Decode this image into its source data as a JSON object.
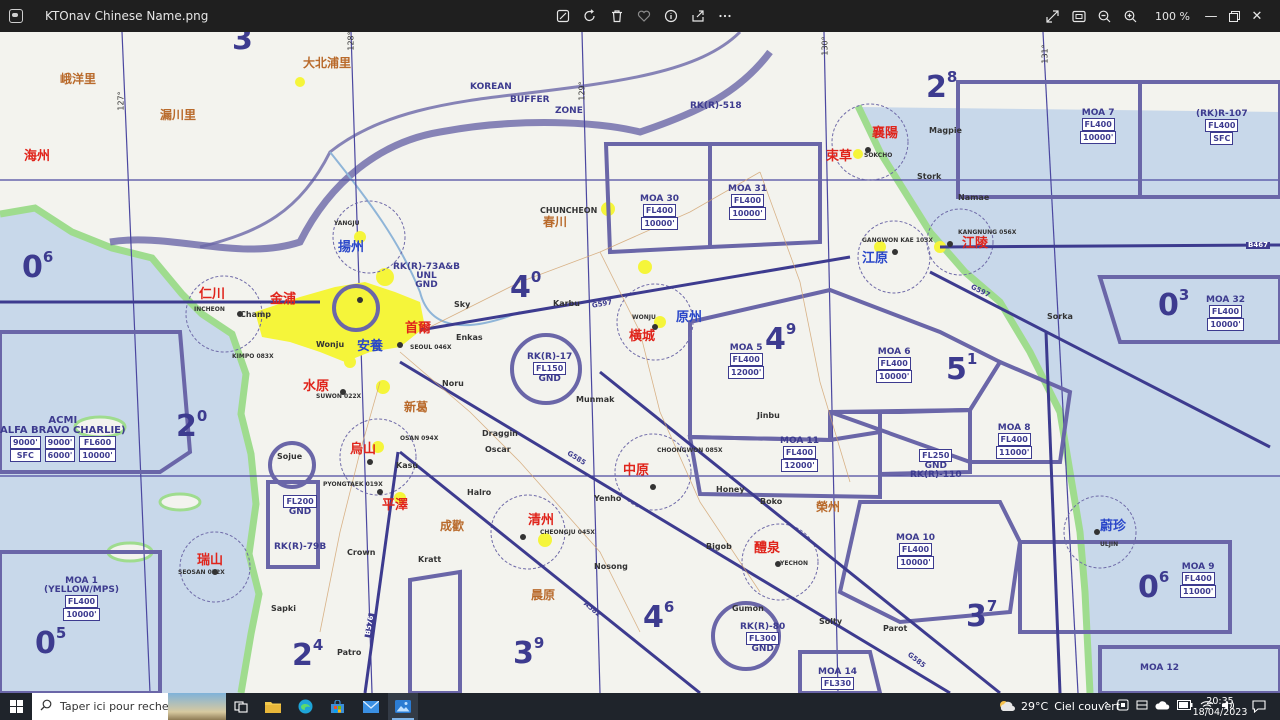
{
  "window": {
    "file_name": "KTOnav Chinese Name.png",
    "zoom": "100 %"
  },
  "toolbar_icons": [
    "edit-icon",
    "rotate-icon",
    "delete-icon",
    "favorite-icon",
    "info-icon",
    "share-icon",
    "more-icon"
  ],
  "map": {
    "red_labels": [
      "海州",
      "仁川",
      "金浦",
      "首爾",
      "水原",
      "烏山",
      "平澤",
      "瑞山",
      "清州",
      "中原",
      "醴泉",
      "襄陽",
      "束草",
      "江陵",
      "橫城"
    ],
    "blue_labels": [
      "揚州",
      "安養",
      "江原",
      "原州",
      "蔚珍"
    ],
    "brown_labels": [
      "峨洋里",
      "漏川里",
      "大北浦里",
      "春川",
      "新葛",
      "成歡",
      "晨原",
      "榮州"
    ],
    "place_names": [
      "CHUNCHEON",
      "KOREAN",
      "BUFFER",
      "ZONE",
      "Magpie",
      "Stork",
      "Namae",
      "Sorka",
      "Karbu",
      "Enkas",
      "Sky",
      "Munmak",
      "Noru",
      "Draggin",
      "Oscar",
      "Halro",
      "Honey",
      "Boko",
      "Yenho",
      "Bigob",
      "Nosong",
      "Kratt",
      "Crown",
      "Sapki",
      "Patro",
      "Solty",
      "Parot",
      "Gumon",
      "Jinbu",
      "Kasu",
      "Sojue",
      "Champ",
      "Wonju"
    ],
    "moa_areas": [
      {
        "name": "MOA 30",
        "alt": "FL400",
        "floor": "10000'"
      },
      {
        "name": "MOA 31",
        "alt": "FL400",
        "floor": "10000'"
      },
      {
        "name": "MOA 7",
        "alt": "FL400",
        "floor": "10000'"
      },
      {
        "name": "(RK)R-107",
        "alt": "FL400",
        "floor": "SFC"
      },
      {
        "name": "MOA 32",
        "alt": "FL400",
        "floor": "10000'"
      },
      {
        "name": "MOA 5",
        "alt": "FL400",
        "floor": "12000'"
      },
      {
        "name": "MOA 6",
        "alt": "FL400",
        "floor": "10000'"
      },
      {
        "name": "MOA 8",
        "alt": "FL400",
        "floor": "11000'"
      },
      {
        "name": "MOA 11",
        "alt": "FL400",
        "floor": "12000'"
      },
      {
        "name": "MOA 10",
        "alt": "FL400",
        "floor": "10000'"
      },
      {
        "name": "MOA 9",
        "alt": "FL400",
        "floor": "11000'"
      },
      {
        "name": "MOA 1",
        "sub": "(YELLOW/MPS)",
        "alt": "FL400",
        "floor": "10000'"
      },
      {
        "name": "MOA 12",
        "alt": "",
        "floor": ""
      },
      {
        "name": "MOA 14",
        "alt": "FL330",
        "floor": ""
      }
    ],
    "restricted": {
      "rk17": {
        "name": "RK(R)-17",
        "top": "FL150",
        "bottom": "GND"
      },
      "rk73": {
        "name": "RK(R)-73A&B",
        "top": "UNL",
        "bottom": "GND"
      },
      "rk79": {
        "name": "RK(R)-79B",
        "top": "FL200",
        "bottom": "GND"
      },
      "rk110": {
        "name": "RK(R)-110",
        "top": "FL250",
        "bottom": "GND"
      },
      "rk80": {
        "name": "RK(R)-80",
        "top": "FL300",
        "bottom": "GND"
      },
      "rk518": {
        "name": "RK(R)-518"
      }
    },
    "acmi": {
      "name": "ACMI",
      "sub": "ALFA BRAVO CHARLIE)",
      "cols": [
        [
          "9000'",
          "SFC"
        ],
        [
          "9000'",
          "6000'"
        ],
        [
          "FL600",
          "10000'"
        ]
      ]
    },
    "grid_numbers": [
      {
        "n": "2",
        "s": "8"
      },
      {
        "n": "0",
        "s": "6"
      },
      {
        "n": "4",
        "s": "0"
      },
      {
        "n": "0",
        "s": "3"
      },
      {
        "n": "4",
        "s": "9"
      },
      {
        "n": "5",
        "s": "1"
      },
      {
        "n": "2",
        "s": "0"
      },
      {
        "n": "0",
        "s": "6"
      },
      {
        "n": "3",
        "s": "7"
      },
      {
        "n": "0",
        "s": "5"
      },
      {
        "n": "2",
        "s": "4"
      },
      {
        "n": "3",
        "s": "9"
      },
      {
        "n": "4",
        "s": "6"
      },
      {
        "n": "3",
        "s": ""
      }
    ],
    "routes": [
      "G597",
      "G585",
      "A582",
      "B467",
      "G597",
      "B576",
      "G585"
    ],
    "meridians": [
      "128°",
      "129°",
      "130°",
      "131°",
      "127°"
    ],
    "airports_small": [
      "SEOUL 046X",
      "SUWON 022X",
      "OSAN 094X",
      "PYONGTAEK 019X",
      "CHEONGJU 045X",
      "WONJU",
      "CHOONGWON 085X",
      "YECHON",
      "GANGWON KAE 103X",
      "KANGNUNG 056X",
      "SEOSAN 052X",
      "KIMPO 083X",
      "YANGJU",
      "SOKCHO",
      "ULJIN",
      "INCHEON"
    ]
  },
  "taskbar": {
    "search_placeholder": "Taper ici pour rechercher",
    "weather_temp": "29°C",
    "weather_text": "Ciel couvert",
    "time": "20:35",
    "date": "18/04/2023"
  },
  "colors": {
    "airspace": "#3d3b8f",
    "urban": "#f5f53a",
    "land": "#f3f3ee",
    "water": "#c8d8ea",
    "coast": "#9fdc8e",
    "redlabel": "#e0241b",
    "bluelabel": "#2a47c9"
  }
}
